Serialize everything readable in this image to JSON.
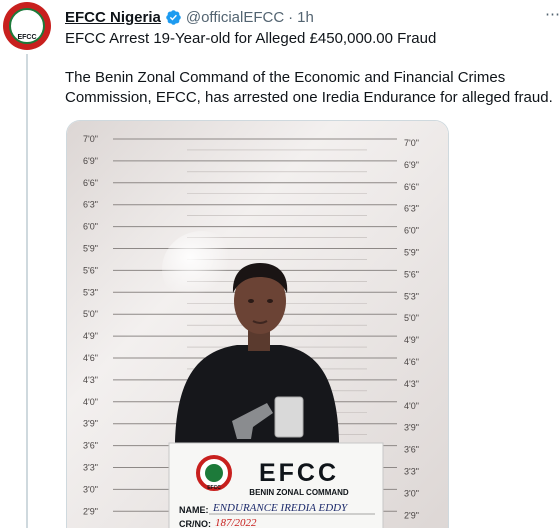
{
  "tweet": {
    "display_name": "EFCC Nigeria",
    "handle": "@officialEFCC",
    "separator": "·",
    "time": "1h",
    "avatar_label": "EFCC",
    "text_line1": "EFCC Arrest 19-Year-old for Alleged £450,000.00 Fraud",
    "text_line2": "The Benin Zonal Command of the Economic and Financial Crimes",
    "text_line3": "Commission, EFCC, has arrested one Iredia Endurance for alleged fraud."
  },
  "photo": {
    "height_marks_left": [
      "7'0\"",
      "6'9\"",
      "6'6\"",
      "6'3\"",
      "6'0\"",
      "5'9\"",
      "5'6\"",
      "5'3\"",
      "5'0\"",
      "4'9\"",
      "4'6\"",
      "4'3\"",
      "4'0\"",
      "3'9\"",
      "3'6\"",
      "3'3\"",
      "3'0\"",
      "2'9\""
    ],
    "height_marks_right": [
      "7'0\"",
      "6'9\"",
      "6'6\"",
      "6'3\"",
      "6'0\"",
      "5'9\"",
      "5'6\"",
      "5'3\"",
      "5'0\"",
      "4'9\"",
      "4'6\"",
      "4'3\"",
      "4'0\"",
      "3'9\"",
      "3'6\"",
      "3'3\"",
      "3'0\"",
      "2'9\""
    ],
    "placard": {
      "agency": "EFCC",
      "command": "BENIN ZONAL COMMAND",
      "logo_text": "EFCC",
      "name_label": "NAME:",
      "name_value": "ENDURANCE IREDIA EDDY",
      "crno_label": "CR/NO:",
      "crno_value": "187/2022"
    }
  },
  "colors": {
    "brand_red": "#c8201e",
    "link_gray": "#536471",
    "verified_blue": "#1d9bf0",
    "wall": "#e9e4e2",
    "placard_green": "#1d7a3a"
  }
}
